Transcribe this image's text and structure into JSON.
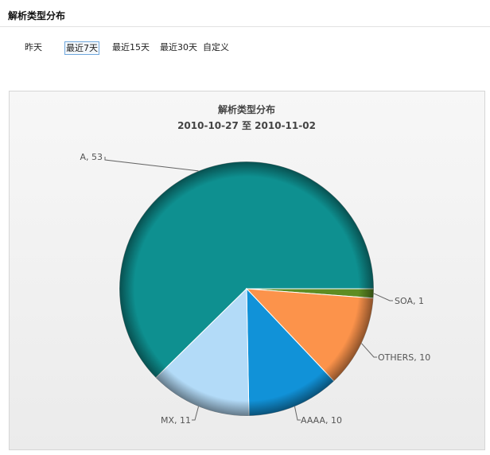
{
  "header": {
    "title": "解析类型分布"
  },
  "range_tabs": [
    {
      "label": "昨天",
      "active": false
    },
    {
      "label": "最近7天",
      "active": true
    },
    {
      "label": "最近15天",
      "active": false
    },
    {
      "label": "最近30天",
      "active": false
    },
    {
      "label": "自定义",
      "active": false
    }
  ],
  "chart_data": {
    "type": "pie",
    "title": "解析类型分布",
    "subtitle": "2010-10-27 至 2010-11-02",
    "slices": [
      {
        "name": "A",
        "value": 53,
        "label": "A, 53",
        "color": "#0e9090"
      },
      {
        "name": "SOA",
        "value": 1,
        "label": "SOA, 1",
        "color": "#5d8d23"
      },
      {
        "name": "OTHERS",
        "value": 10,
        "label": "OTHERS, 10",
        "color": "#fc934b"
      },
      {
        "name": "AAAA",
        "value": 10,
        "label": "AAAA, 10",
        "color": "#1192d8"
      },
      {
        "name": "MX",
        "value": 11,
        "label": "MX, 11",
        "color": "#b3dbf8"
      }
    ]
  }
}
